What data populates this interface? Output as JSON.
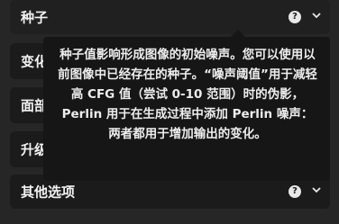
{
  "sections": {
    "seed": {
      "label": "种子"
    },
    "variation": {
      "label": "变化"
    },
    "face": {
      "label": "面部"
    },
    "upscale": {
      "label": "升级"
    },
    "other": {
      "label": "其他选项"
    }
  },
  "tooltip": {
    "text": "种子值影响形成图像的初始噪声。您可以使用以前图像中已经存在的种子。“噪声阈值”用于减轻高 CFG 值（尝试 0-10 范围）时的伪影，Perlin 用于在生成过程中添加 Perlin 噪声：两者都用于增加输出的变化。"
  },
  "icons": {
    "help": "?",
    "chevron": "chevron-down"
  }
}
